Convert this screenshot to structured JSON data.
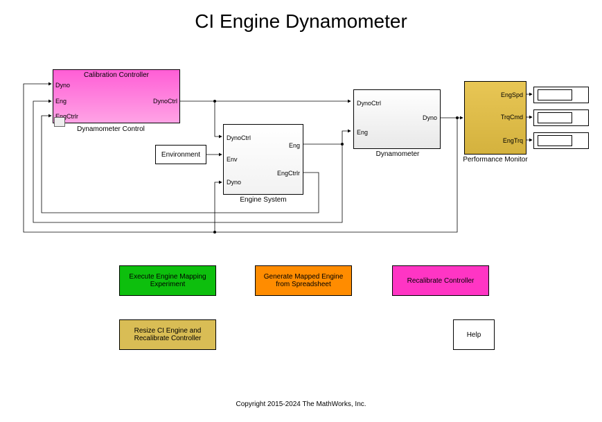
{
  "title": "CI Engine Dynamometer",
  "blocks": {
    "calibration_controller": {
      "title": "Calibration Controller",
      "label": "Dynamometer Control",
      "ports": {
        "in1": "Dyno",
        "in2": "Eng",
        "in3": "EngCtrlr",
        "out": "DynoCtrl"
      }
    },
    "environment": {
      "label": "Environment"
    },
    "engine_system": {
      "label": "Engine System",
      "ports": {
        "in1": "DynoCtrl",
        "in2": "Env",
        "in3": "Dyno",
        "out1": "Eng",
        "out2": "EngCtrlr"
      }
    },
    "dynamometer": {
      "label": "Dynamometer",
      "ports": {
        "in1": "DynoCtrl",
        "in2": "Eng",
        "out": "Dyno"
      }
    },
    "performance_monitor": {
      "label": "Performance Monitor",
      "ports": {
        "out1": "EngSpd",
        "out2": "TrqCmd",
        "out3": "EngTrq"
      }
    }
  },
  "buttons": {
    "exec_mapping": "Execute Engine Mapping Experiment",
    "gen_mapped": "Generate Mapped Engine from Spreadsheet",
    "recalibrate": "Recalibrate Controller",
    "resize": "Resize CI Engine and Recalibrate Controller",
    "help": "Help"
  },
  "copyright": "Copyright 2015-2024 The MathWorks, Inc."
}
